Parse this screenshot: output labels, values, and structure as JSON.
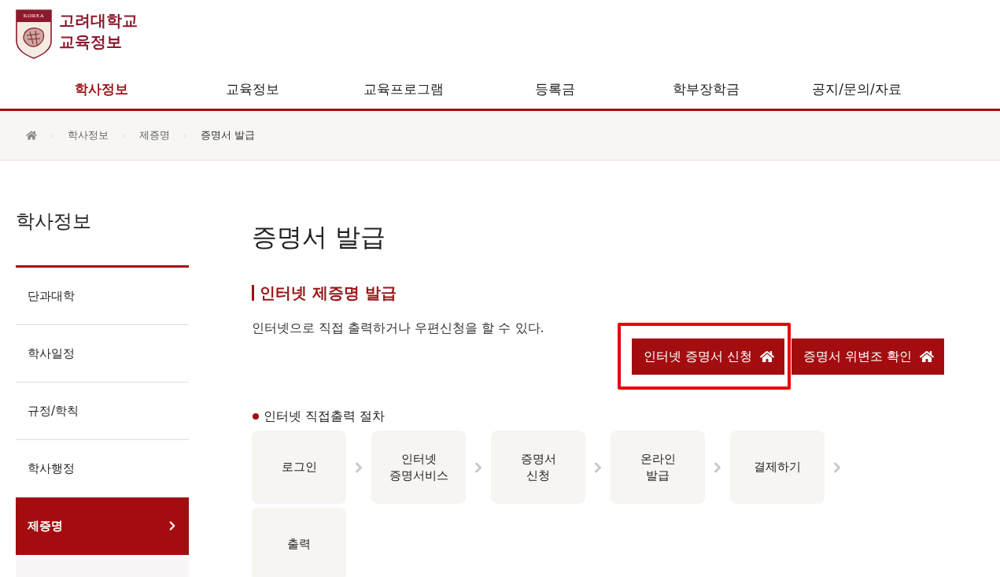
{
  "header": {
    "logo": {
      "emblem_text": "KOREA",
      "title_lines": [
        "고려대학교",
        "교육정보"
      ]
    }
  },
  "nav": [
    {
      "label": "학사정보",
      "selected": true
    },
    {
      "label": "교육정보",
      "selected": false
    },
    {
      "label": "교육프로그램",
      "selected": false
    },
    {
      "label": "등록금",
      "selected": false
    },
    {
      "label": "학부장학금",
      "selected": false
    },
    {
      "label": "공지/문의/자료",
      "selected": false
    }
  ],
  "breadcrumb": [
    "학사정보",
    "제증명",
    "증명서 발급"
  ],
  "sidebar": {
    "title": "학사정보",
    "items": [
      {
        "label": "단과대학",
        "selected": false,
        "expanded": false
      },
      {
        "label": "학사일정",
        "selected": false,
        "expanded": false
      },
      {
        "label": "규정/학칙",
        "selected": false,
        "expanded": false
      },
      {
        "label": "학사행정",
        "selected": false,
        "expanded": false
      },
      {
        "label": "제증명",
        "selected": true,
        "expanded": true
      }
    ]
  },
  "content": {
    "title": "증명서 발급",
    "section": {
      "heading": "인터넷 제증명 발급",
      "description": "인터넷으로 직접 출력하거나 우편신청을 할 수 있다.",
      "buttons": [
        {
          "label": "인터넷 증명서 신청",
          "highlighted": true
        },
        {
          "label": "증명서 위변조 확인",
          "highlighted": false
        }
      ]
    },
    "procedure": {
      "title": "인터넷 직접출력 절차",
      "steps": [
        {
          "label": "로그인"
        },
        {
          "label": "인터넷\n증명서비스"
        },
        {
          "label": "증명서\n신청"
        },
        {
          "label": "온라인\n발급"
        },
        {
          "label": "결제하기"
        },
        {
          "label": "출력"
        }
      ]
    }
  }
}
